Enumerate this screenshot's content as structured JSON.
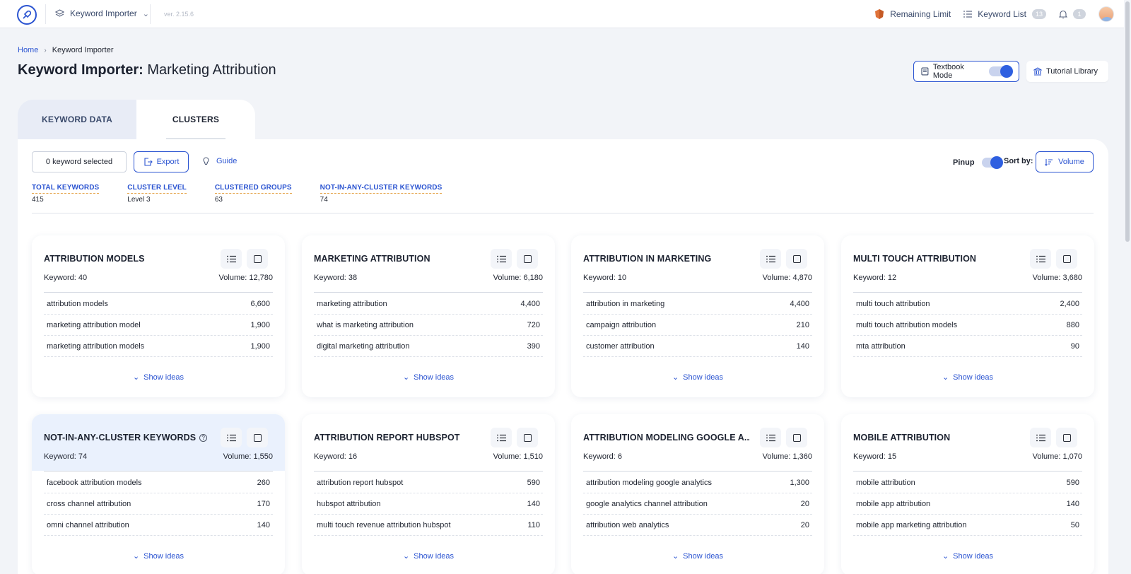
{
  "topbar": {
    "project": "Keyword Importer",
    "version": "ver. 2.15.6",
    "remaining_limit": "Remaining Limit",
    "keyword_list": "Keyword List",
    "keyword_list_count": "13",
    "notifications_count": "1"
  },
  "breadcrumb": {
    "home": "Home",
    "current": "Keyword Importer"
  },
  "page": {
    "title_bold": "Keyword Importer:",
    "title_rest": " Marketing Attribution"
  },
  "actions": {
    "textbook_mode": "Textbook Mode",
    "textbook_mode_on": true,
    "tutorial_library": "Tutorial Library"
  },
  "tabs": {
    "keyword_data": "KEYWORD DATA",
    "clusters": "CLUSTERS",
    "active": "clusters"
  },
  "toolbar": {
    "selected": "0 keyword selected",
    "export": "Export",
    "guide": "Guide",
    "pinup": "Pinup",
    "pinup_on": true,
    "sort_by": "Sort by:",
    "sort_value": "Volume"
  },
  "stats": [
    {
      "label": "TOTAL KEYWORDS",
      "value": "415"
    },
    {
      "label": "CLUSTER LEVEL",
      "value": "Level 3"
    },
    {
      "label": "CLUSTERED GROUPS",
      "value": "63"
    },
    {
      "label": "NOT-IN-ANY-CLUSTER KEYWORDS",
      "value": "74"
    }
  ],
  "show_ideas": "Show ideas",
  "clusters": [
    {
      "title": "ATTRIBUTION MODELS",
      "keyword": "Keyword: 40",
      "volume": "Volume: 12,780",
      "rows": [
        {
          "kw": "attribution models",
          "vol": "6,600"
        },
        {
          "kw": "marketing attribution model",
          "vol": "1,900"
        },
        {
          "kw": "marketing attribution models",
          "vol": "1,900"
        }
      ]
    },
    {
      "title": "MARKETING ATTRIBUTION",
      "keyword": "Keyword: 38",
      "volume": "Volume: 6,180",
      "rows": [
        {
          "kw": "marketing attribution",
          "vol": "4,400"
        },
        {
          "kw": "what is marketing attribution",
          "vol": "720"
        },
        {
          "kw": "digital marketing attribution",
          "vol": "390"
        }
      ]
    },
    {
      "title": "ATTRIBUTION IN MARKETING",
      "keyword": "Keyword: 10",
      "volume": "Volume: 4,870",
      "rows": [
        {
          "kw": "attribution in marketing",
          "vol": "4,400"
        },
        {
          "kw": "campaign attribution",
          "vol": "210"
        },
        {
          "kw": "customer attribution",
          "vol": "140"
        }
      ]
    },
    {
      "title": "MULTI TOUCH ATTRIBUTION",
      "keyword": "Keyword: 12",
      "volume": "Volume: 3,680",
      "rows": [
        {
          "kw": "multi touch attribution",
          "vol": "2,400"
        },
        {
          "kw": "multi touch attribution models",
          "vol": "880"
        },
        {
          "kw": "mta attribution",
          "vol": "90"
        }
      ]
    },
    {
      "title": "NOT-IN-ANY-CLUSTER KEYWORDS",
      "keyword": "Keyword: 74",
      "volume": "Volume: 1,550",
      "rows": [
        {
          "kw": "facebook attribution models",
          "vol": "260"
        },
        {
          "kw": "cross channel attribution",
          "vol": "170"
        },
        {
          "kw": "omni channel attribution",
          "vol": "140"
        }
      ]
    },
    {
      "title": "ATTRIBUTION REPORT HUBSPOT",
      "keyword": "Keyword: 16",
      "volume": "Volume: 1,510",
      "rows": [
        {
          "kw": "attribution report hubspot",
          "vol": "590"
        },
        {
          "kw": "hubspot attribution",
          "vol": "140"
        },
        {
          "kw": "multi touch revenue attribution hubspot",
          "vol": "110"
        }
      ]
    },
    {
      "title": "ATTRIBUTION MODELING GOOGLE A...",
      "keyword": "Keyword: 6",
      "volume": "Volume: 1,360",
      "rows": [
        {
          "kw": "attribution modeling google analytics",
          "vol": "1,300"
        },
        {
          "kw": "google analytics channel attribution",
          "vol": "20"
        },
        {
          "kw": "attribution web analytics",
          "vol": "20"
        }
      ]
    },
    {
      "title": "MOBILE ATTRIBUTION",
      "keyword": "Keyword: 15",
      "volume": "Volume: 1,070",
      "rows": [
        {
          "kw": "mobile attribution",
          "vol": "590"
        },
        {
          "kw": "mobile app attribution",
          "vol": "140"
        },
        {
          "kw": "mobile app marketing attribution",
          "vol": "50"
        }
      ]
    }
  ],
  "colors": {
    "accent": "#2b54d1",
    "toggle_on": "#2e5fe0",
    "highlight_bg": "#eaf1fd"
  }
}
